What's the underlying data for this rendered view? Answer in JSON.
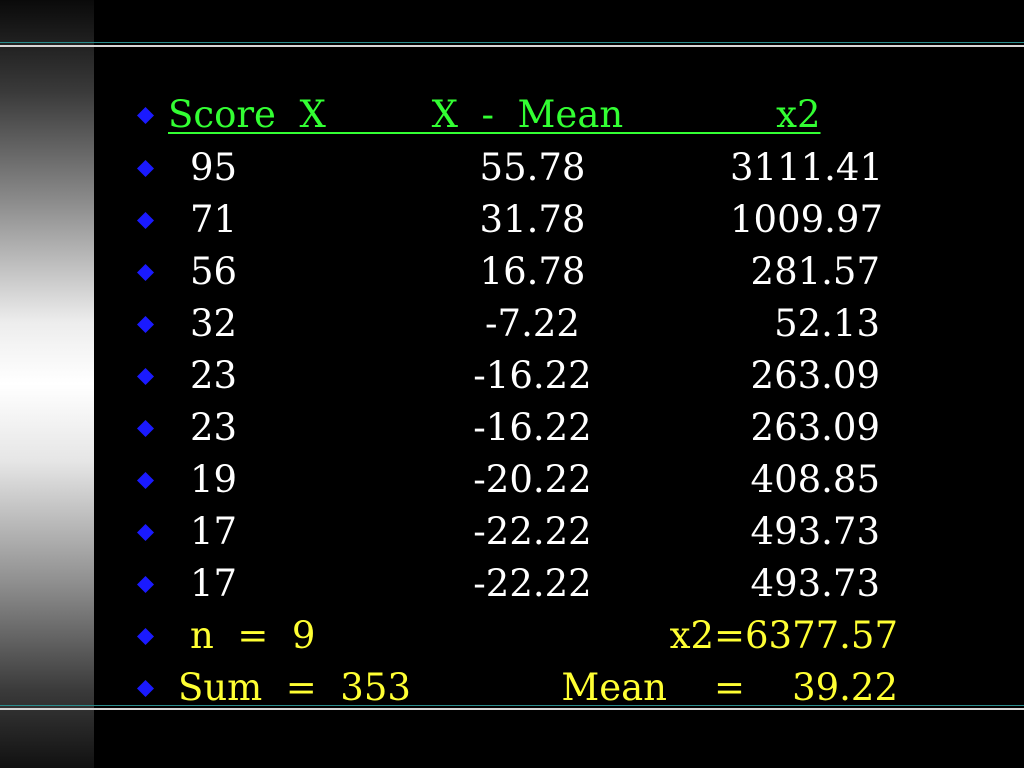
{
  "header": {
    "text": "Score  X         X  -  Mean             x2",
    "color": "#33ff33"
  },
  "columns": [
    "Score  X",
    "X  -  Mean",
    "x2"
  ],
  "rows": [
    {
      "x": "95",
      "dev": "55.78",
      "sq": "3111.41"
    },
    {
      "x": "71",
      "dev": "31.78",
      "sq": "1009.97"
    },
    {
      "x": "56",
      "dev": "16.78",
      "sq": "281.57"
    },
    {
      "x": "32",
      "dev": "-7.22",
      "sq": "52.13"
    },
    {
      "x": "23",
      "dev": "-16.22",
      "sq": "263.09"
    },
    {
      "x": "23",
      "dev": "-16.22",
      "sq": "263.09"
    },
    {
      "x": "19",
      "dev": "-20.22",
      "sq": "408.85"
    },
    {
      "x": "17",
      "dev": "-22.22",
      "sq": "493.73"
    },
    {
      "x": "17",
      "dev": "-22.22",
      "sq": "493.73"
    }
  ],
  "summary": {
    "n_label": "n  =  9",
    "sum_sq": "x2=6377.57",
    "sum_label": "Sum  =  353",
    "mean_label": "Mean    =    39.22",
    "color": "#ffff33"
  },
  "bullet_color": "#1a1aff"
}
